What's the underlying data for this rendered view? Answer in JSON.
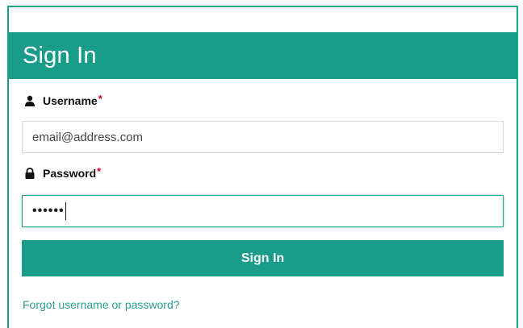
{
  "header": {
    "title": "Sign In"
  },
  "username": {
    "label": "Username",
    "required_marker": "*",
    "icon": "user-icon",
    "placeholder": "email@address.com",
    "value": ""
  },
  "password": {
    "label": "Password",
    "required_marker": "*",
    "icon": "lock-icon",
    "masked_value": "••••••"
  },
  "actions": {
    "signin_label": "Sign In",
    "forgot_label": "Forgot username or password?"
  },
  "colors": {
    "accent": "#1a9c8b",
    "link": "#2a9d8f",
    "required": "#d0021b"
  }
}
